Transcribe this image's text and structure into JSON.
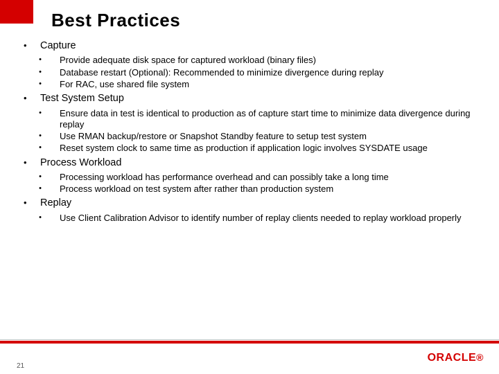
{
  "title": "Best Practices",
  "sections": [
    {
      "title": "Capture",
      "items": [
        "Provide adequate disk space for captured workload (binary files)",
        "Database restart (Optional): Recommended to minimize divergence during replay",
        "For RAC, use shared file system"
      ]
    },
    {
      "title": "Test System Setup",
      "items": [
        "Ensure data in test is identical to production as of capture start time to minimize data divergence during replay",
        "Use RMAN backup/restore or Snapshot Standby feature to setup test system",
        "Reset system clock to same time as production if application logic involves SYSDATE usage"
      ]
    },
    {
      "title": "Process Workload",
      "items": [
        "Processing workload has performance overhead and can possibly take a long time",
        "Process workload on test system after rather than production system"
      ]
    },
    {
      "title": "Replay",
      "items": [
        "Use Client Calibration Advisor to identify number of replay clients needed to replay workload properly"
      ]
    }
  ],
  "slide_number": "21",
  "brand": "ORACLE"
}
